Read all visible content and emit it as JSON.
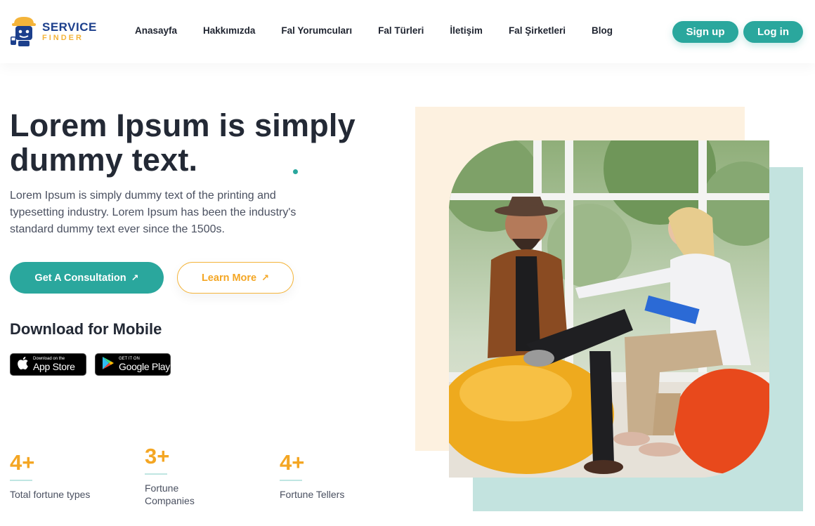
{
  "header": {
    "logo": {
      "line1": "SERVICE",
      "line2": "FINDER"
    },
    "nav": [
      "Anasayfa",
      "Hakkımızda",
      "Fal Yorumcuları",
      "Fal Türleri",
      "İletişim",
      "Fal Şirketleri",
      "Blog"
    ],
    "signup_label": "Sign up",
    "login_label": "Log in"
  },
  "hero": {
    "title": "Lorem Ipsum is simply dummy text.",
    "description": "Lorem Ipsum is simply dummy text of the printing and typesetting industry. Lorem Ipsum has been the industry's standard dummy text ever since the 1500s.",
    "consult_label": "Get A Consultation",
    "learn_label": "Learn More"
  },
  "download": {
    "title": "Download for Mobile",
    "apple": {
      "small": "Download on the",
      "large": "App Store"
    },
    "google": {
      "small": "GET IT ON",
      "large": "Google Play"
    }
  },
  "stats": [
    {
      "value": "4+",
      "label": "Total fortune types"
    },
    {
      "value": "3+",
      "label": "Fortune Companies"
    },
    {
      "value": "4+",
      "label": "Fortune Tellers"
    }
  ],
  "colors": {
    "accent": "#2aa79d",
    "secondary": "#f4a623",
    "brand": "#1c3f8c",
    "panel_cream": "#fdf1e0",
    "panel_teal": "#c3e3df"
  },
  "icons": [
    "logo-mascot-icon",
    "arrow-up-right-icon",
    "apple-icon",
    "google-play-icon"
  ]
}
